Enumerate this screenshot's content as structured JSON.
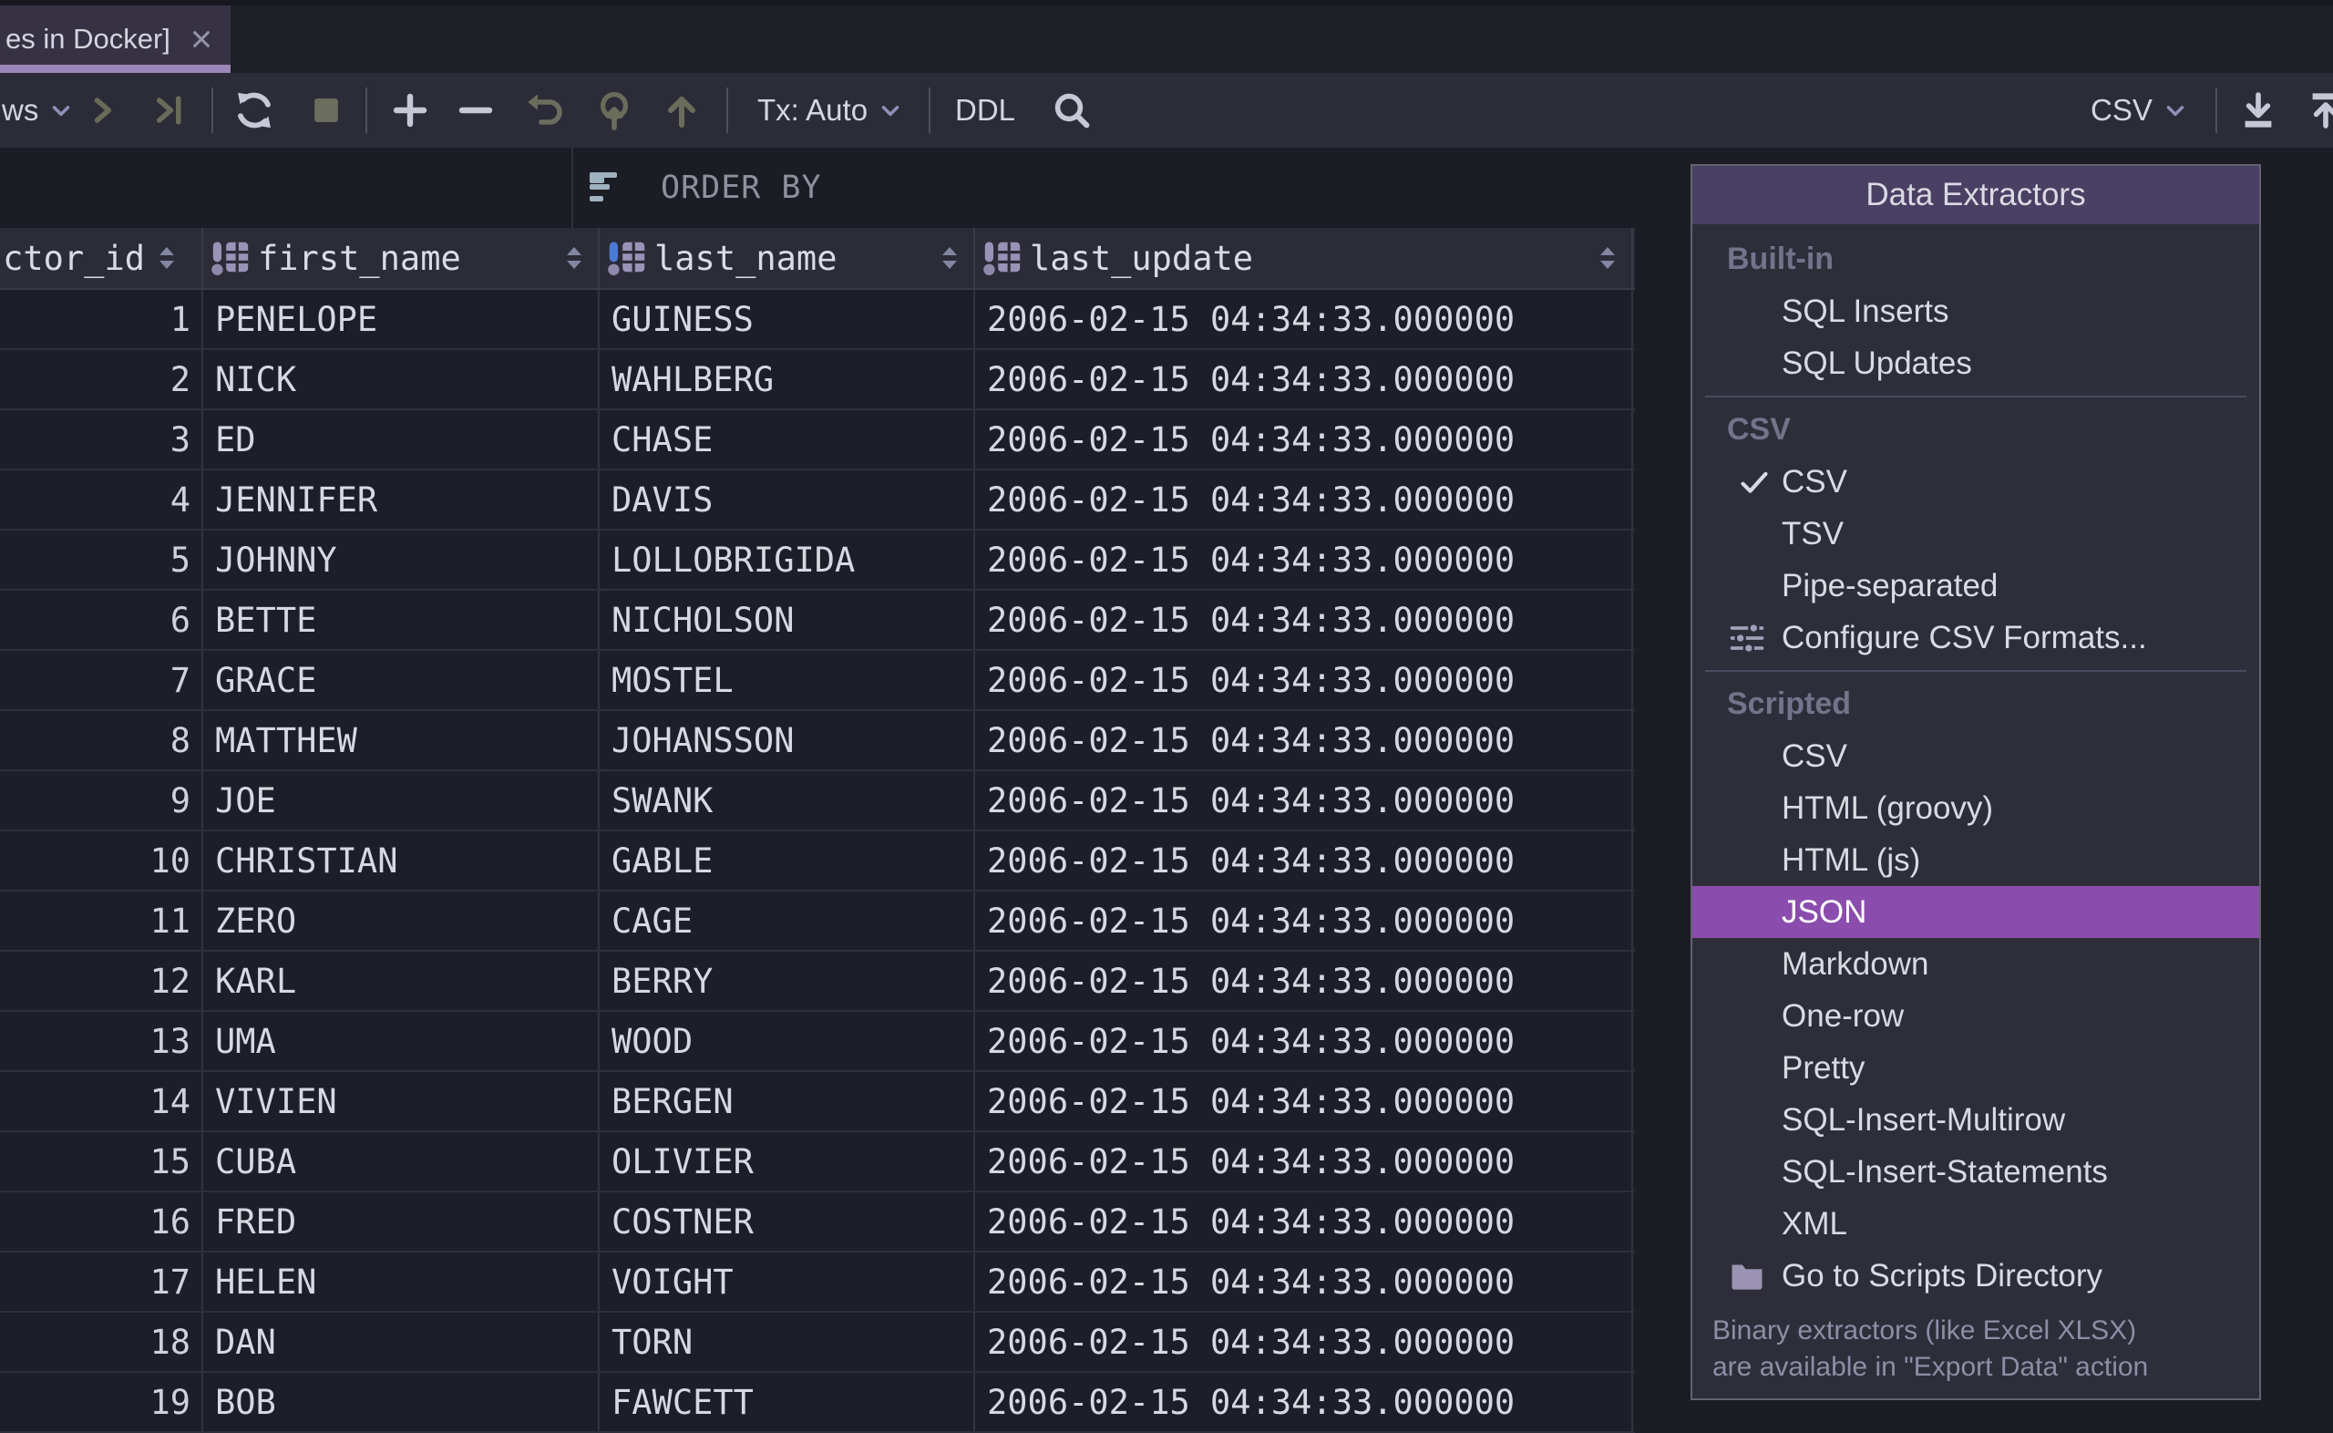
{
  "tab": {
    "title": "es in Docker]"
  },
  "toolbar": {
    "rows_dropdown": "ws",
    "tx_mode": "Tx: Auto",
    "ddl": "DDL",
    "extractor": "CSV"
  },
  "filter_bar": {
    "order_by": "ORDER BY"
  },
  "grid": {
    "columns": [
      {
        "label": "ctor_id",
        "icon": false,
        "accent": "purple",
        "align": "right"
      },
      {
        "label": "first_name",
        "icon": true,
        "accent": "purple",
        "align": "left"
      },
      {
        "label": "last_name",
        "icon": true,
        "accent": "blue",
        "align": "left"
      },
      {
        "label": "last_update",
        "icon": true,
        "accent": "purple",
        "align": "left"
      }
    ],
    "rows": [
      [
        "1",
        "PENELOPE",
        "GUINESS",
        "2006-02-15 04:34:33.000000"
      ],
      [
        "2",
        "NICK",
        "WAHLBERG",
        "2006-02-15 04:34:33.000000"
      ],
      [
        "3",
        "ED",
        "CHASE",
        "2006-02-15 04:34:33.000000"
      ],
      [
        "4",
        "JENNIFER",
        "DAVIS",
        "2006-02-15 04:34:33.000000"
      ],
      [
        "5",
        "JOHNNY",
        "LOLLOBRIGIDA",
        "2006-02-15 04:34:33.000000"
      ],
      [
        "6",
        "BETTE",
        "NICHOLSON",
        "2006-02-15 04:34:33.000000"
      ],
      [
        "7",
        "GRACE",
        "MOSTEL",
        "2006-02-15 04:34:33.000000"
      ],
      [
        "8",
        "MATTHEW",
        "JOHANSSON",
        "2006-02-15 04:34:33.000000"
      ],
      [
        "9",
        "JOE",
        "SWANK",
        "2006-02-15 04:34:33.000000"
      ],
      [
        "10",
        "CHRISTIAN",
        "GABLE",
        "2006-02-15 04:34:33.000000"
      ],
      [
        "11",
        "ZERO",
        "CAGE",
        "2006-02-15 04:34:33.000000"
      ],
      [
        "12",
        "KARL",
        "BERRY",
        "2006-02-15 04:34:33.000000"
      ],
      [
        "13",
        "UMA",
        "WOOD",
        "2006-02-15 04:34:33.000000"
      ],
      [
        "14",
        "VIVIEN",
        "BERGEN",
        "2006-02-15 04:34:33.000000"
      ],
      [
        "15",
        "CUBA",
        "OLIVIER",
        "2006-02-15 04:34:33.000000"
      ],
      [
        "16",
        "FRED",
        "COSTNER",
        "2006-02-15 04:34:33.000000"
      ],
      [
        "17",
        "HELEN",
        "VOIGHT",
        "2006-02-15 04:34:33.000000"
      ],
      [
        "18",
        "DAN",
        "TORN",
        "2006-02-15 04:34:33.000000"
      ],
      [
        "19",
        "BOB",
        "FAWCETT",
        "2006-02-15 04:34:33.000000"
      ]
    ]
  },
  "extractor_menu": {
    "title": "Data Extractors",
    "sections": [
      {
        "label": "Built-in",
        "items": [
          {
            "label": "SQL Inserts"
          },
          {
            "label": "SQL Updates"
          }
        ]
      },
      {
        "label": "CSV",
        "items": [
          {
            "label": "CSV",
            "checked": true
          },
          {
            "label": "TSV"
          },
          {
            "label": "Pipe-separated"
          },
          {
            "label": "Configure CSV Formats...",
            "icon": "sliders-icon"
          }
        ]
      },
      {
        "label": "Scripted",
        "items": [
          {
            "label": "CSV"
          },
          {
            "label": "HTML (groovy)"
          },
          {
            "label": "HTML (js)"
          },
          {
            "label": "JSON",
            "selected": true
          },
          {
            "label": "Markdown"
          },
          {
            "label": "One-row"
          },
          {
            "label": "Pretty"
          },
          {
            "label": "SQL-Insert-Multirow"
          },
          {
            "label": "SQL-Insert-Statements"
          },
          {
            "label": "XML"
          },
          {
            "label": "Go to Scripts Directory",
            "icon": "folder-icon"
          }
        ]
      }
    ],
    "footer": [
      "Binary extractors (like Excel XLSX)",
      "are available in \"Export Data\" action"
    ]
  },
  "icons": [
    "close-icon",
    "chevron-down-icon",
    "next-page-icon",
    "last-page-icon",
    "refresh-icon",
    "stop-icon",
    "plus-icon",
    "minus-icon",
    "undo-icon",
    "submit-icon",
    "upload-arrow-icon",
    "search-icon",
    "export-download-icon",
    "import-upload-icon",
    "sort-order-icon",
    "column-icon",
    "sort-widget-icon",
    "check-icon",
    "sliders-icon",
    "folder-icon"
  ],
  "colors": {
    "accent": "#8b4dad",
    "menu_header": "#4a4063",
    "tab_underline": "#9c87b8",
    "index_blue": "#4a79d8",
    "icon_purple": "#9a93b8"
  }
}
